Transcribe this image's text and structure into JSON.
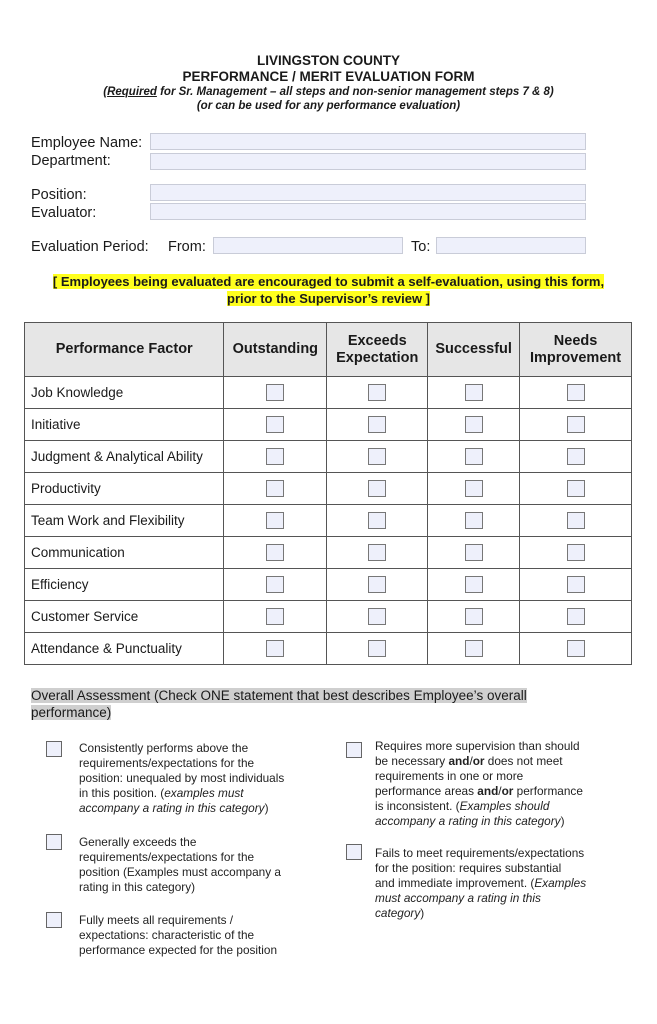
{
  "header": {
    "title_line1": "LIVINGSTON COUNTY",
    "title_line2": "PERFORMANCE / MERIT EVALUATION FORM",
    "required_word": "Required",
    "subtitle_line1_rest": " for Sr. Management – all steps and non-senior management steps 7 & 8)",
    "subtitle_line1_open": "(",
    "subtitle_line2": "(or can be used for any performance evaluation)"
  },
  "fields": {
    "employee_name_label": "Employee Name:",
    "employee_name_value": "",
    "department_label": "Department:",
    "department_value": "",
    "position_label": "Position:",
    "position_value": "",
    "evaluator_label": "Evaluator:",
    "evaluator_value": "",
    "evaluation_period_label": "Evaluation Period:",
    "from_label": "From:",
    "from_value": "",
    "to_label": "To:",
    "to_value": ""
  },
  "notice": {
    "line1": "[ Employees being evaluated are encouraged to submit a self-evaluation, using this form,",
    "line2": "prior to the Supervisor’s review ]",
    "highlight_color": "#ffff1e"
  },
  "table": {
    "headers": {
      "factor": "Performance Factor",
      "outstanding": "Outstanding",
      "exceeds_line1": "Exceeds",
      "exceeds_line2": "Expectation",
      "successful": "Successful",
      "needs_line1": "Needs",
      "needs_line2": "Improvement"
    },
    "rows": [
      {
        "factor": "Job Knowledge",
        "outstanding": false,
        "exceeds": false,
        "successful": false,
        "needs_improvement": false
      },
      {
        "factor": "Initiative",
        "outstanding": false,
        "exceeds": false,
        "successful": false,
        "needs_improvement": false
      },
      {
        "factor": "Judgment & Analytical Ability",
        "outstanding": false,
        "exceeds": false,
        "successful": false,
        "needs_improvement": false
      },
      {
        "factor": "Productivity",
        "outstanding": false,
        "exceeds": false,
        "successful": false,
        "needs_improvement": false
      },
      {
        "factor": "Team Work and Flexibility",
        "outstanding": false,
        "exceeds": false,
        "successful": false,
        "needs_improvement": false
      },
      {
        "factor": "Communication",
        "outstanding": false,
        "exceeds": false,
        "successful": false,
        "needs_improvement": false
      },
      {
        "factor": "Efficiency",
        "outstanding": false,
        "exceeds": false,
        "successful": false,
        "needs_improvement": false
      },
      {
        "factor": "Customer Service",
        "outstanding": false,
        "exceeds": false,
        "successful": false,
        "needs_improvement": false
      },
      {
        "factor": "Attendance & Punctuality",
        "outstanding": false,
        "exceeds": false,
        "successful": false,
        "needs_improvement": false
      }
    ]
  },
  "overall": {
    "heading_line1": "Overall Assessment (Check ONE statement that best describes Employee’s overall",
    "heading_line2": "performance)",
    "options": [
      {
        "checked": false,
        "lines": [
          "Consistently performs above the",
          "requirements/expectations for the",
          "position: unequaled by most individuals"
        ],
        "line4_plain": "in this position.  (",
        "line4_italic": "examples must",
        "line5_italic": "accompany a rating in this category",
        "line5_plain": ")"
      },
      {
        "checked": false,
        "lines": [
          "Generally exceeds the",
          "requirements/expectations for the",
          "position (Examples must accompany a",
          "rating in this category)"
        ]
      },
      {
        "checked": false,
        "lines": [
          "Fully meets all requirements /",
          "expectations: characteristic of the",
          "performance expected for the position"
        ]
      },
      {
        "checked": false,
        "line1": "Requires more supervision than should",
        "line2_a": "be necessary ",
        "line2_bold1": "and",
        "line2_slash": "/",
        "line2_bold2": "or",
        "line2_b": " does not meet",
        "line3": "requirements in one or more",
        "line4_a": "performance areas ",
        "line4_bold1": "and",
        "line4_slash": "/",
        "line4_bold2": "or",
        "line4_b": " performance",
        "line5_plain": "is inconsistent. (",
        "line5_italic": "Examples should",
        "line6_italic": "accompany a rating in this category",
        "line6_plain": ")"
      },
      {
        "checked": false,
        "line1": "Fails to meet requirements/expectations",
        "line2": "for the position:  requires substantial",
        "line3_plain": "and immediate improvement. (",
        "line3_italic": "Examples",
        "line4_italic": "must accompany a rating in this",
        "line5_italic": "category",
        "line5_plain": ")"
      }
    ]
  }
}
